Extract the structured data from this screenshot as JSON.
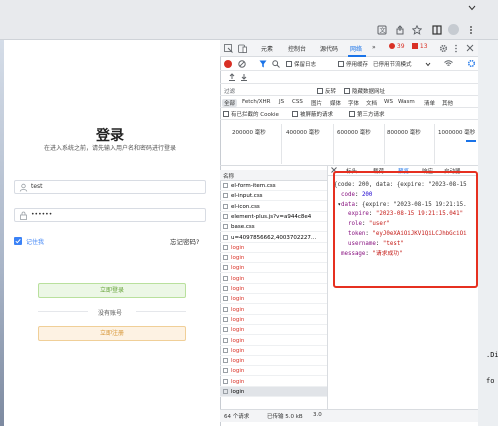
{
  "devtools": {
    "tabs": [
      "元素",
      "控制台",
      "源代码",
      "网络"
    ],
    "more_tabs": "»",
    "error_count": "39",
    "warning_count": "13",
    "toolbar": {
      "preserve_log": "保留日志",
      "disable_cache": "停用缓存",
      "throttle": "已停用节流模式"
    },
    "filter": {
      "placeholder": "过滤",
      "invert": "反转",
      "hide_data_urls": "隐藏数据网址"
    },
    "type_filters": [
      "全部",
      "Fetch/XHR",
      "JS",
      "CSS",
      "图片",
      "媒体",
      "字体",
      "文档",
      "WS",
      "Wasm",
      "清单",
      "其他"
    ],
    "blocked_cookies": "有已拦截的 Cookie",
    "blocked_requests": "被屏蔽的请求",
    "third_party": "第三方请求",
    "timeline_ticks": [
      "200000 毫秒",
      "400000 毫秒",
      "600000 毫秒",
      "800000 毫秒",
      "1000000 毫秒"
    ],
    "name_header": "名称",
    "detail_tabs": [
      "标头",
      "载荷",
      "预览",
      "响应",
      "启动器"
    ],
    "requests": [
      {
        "name": "el-form-item.css",
        "error": false
      },
      {
        "name": "el-input.css",
        "error": false
      },
      {
        "name": "el-icon.css",
        "error": false
      },
      {
        "name": "element-plus.js?v=a944c8e4",
        "error": false
      },
      {
        "name": "base.css",
        "error": false
      },
      {
        "name": "u=4097856662,4003702227…",
        "error": false
      },
      {
        "name": "login",
        "error": true
      },
      {
        "name": "login",
        "error": true
      },
      {
        "name": "login",
        "error": true
      },
      {
        "name": "login",
        "error": true
      },
      {
        "name": "login",
        "error": true
      },
      {
        "name": "login",
        "error": true
      },
      {
        "name": "login",
        "error": true
      },
      {
        "name": "login",
        "error": true
      },
      {
        "name": "login",
        "error": true
      },
      {
        "name": "login",
        "error": true
      },
      {
        "name": "login",
        "error": true
      },
      {
        "name": "login",
        "error": true
      },
      {
        "name": "login",
        "error": true
      },
      {
        "name": "login",
        "error": true
      },
      {
        "name": "login",
        "error": false
      }
    ],
    "status": {
      "requests": "64 个请求",
      "transferred": "已传输 5.0 kB",
      "extra": "3.0"
    },
    "preview": {
      "summary": "{code: 200, data: {expire: \"2023-08-15",
      "code_key": "code",
      "code_val": "200",
      "data_key": "data",
      "data_summary": "{expire: \"2023-08-15 19:21:15.",
      "expire_key": "expire",
      "expire_val": "\"2023-08-15 19:21:15.041\"",
      "role_key": "role",
      "role_val": "\"user\"",
      "token_key": "token",
      "token_val": "\"eyJ0eXAiOiJKV1QiLCJhbGciOi",
      "username_key": "username",
      "username_val": "\"test\"",
      "message_key": "message",
      "message_val": "\"请求成功\""
    }
  },
  "login": {
    "title": "登录",
    "subtitle": "在进入系统之前，请先输入用户名和密码进行登录",
    "username": "test",
    "password": "••••••",
    "remember": "记住我",
    "forgot": "忘记密码?",
    "login_button": "立即登录",
    "no_account": "没有账号",
    "register_button": "立即注册"
  },
  "background_text": [
    ".Di",
    "fo"
  ],
  "colors": {
    "accent": "#3b82f6",
    "error": "#d93025",
    "highlight": "#e63020"
  }
}
